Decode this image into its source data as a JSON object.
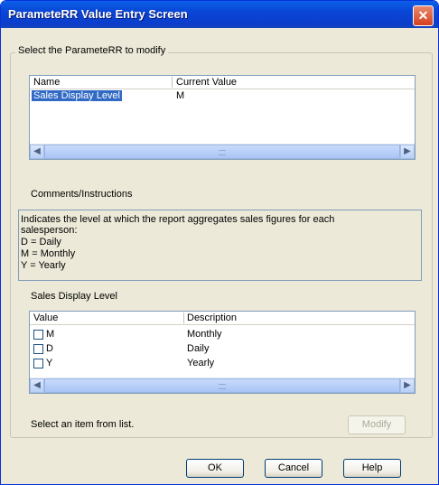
{
  "window": {
    "title": "ParameteRR Value Entry Screen"
  },
  "param_group": {
    "label": "Select the ParameteRR to modify",
    "columns": [
      "Name",
      "Current Value"
    ],
    "rows": [
      {
        "name": "Sales Display Level",
        "value": "M"
      }
    ]
  },
  "comments": {
    "label": "Comments/Instructions",
    "lines": [
      "Indicates the level at which the report aggregates sales figures for each",
      "salesperson:",
      "D = Daily",
      "M = Monthly",
      "Y = Yearly"
    ]
  },
  "value_list": {
    "label": "Sales Display Level",
    "columns": [
      "Value",
      "Description"
    ],
    "rows": [
      {
        "value": "M",
        "description": "Monthly"
      },
      {
        "value": "D",
        "description": "Daily"
      },
      {
        "value": "Y",
        "description": "Yearly"
      }
    ]
  },
  "status_text": "Select an item from list.",
  "buttons": {
    "modify": "Modify",
    "ok": "OK",
    "cancel": "Cancel",
    "help": "Help"
  }
}
